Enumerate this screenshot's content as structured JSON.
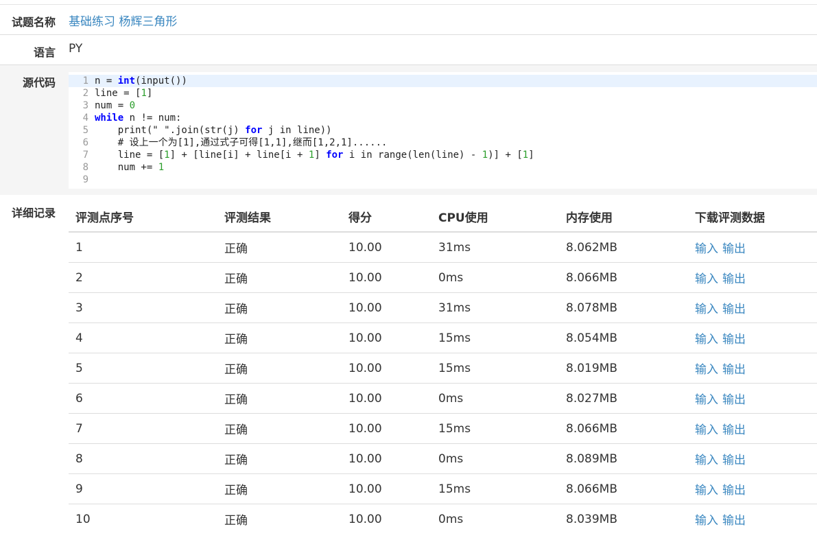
{
  "problem": {
    "label": "试题名称",
    "value": "基础练习 杨辉三角形"
  },
  "language": {
    "label": "语言",
    "value": "PY"
  },
  "source": {
    "label": "源代码",
    "lines": [
      {
        "num": "1",
        "parts": [
          [
            "t",
            "n = "
          ],
          [
            "k",
            "int"
          ],
          [
            "t",
            "(input())"
          ]
        ]
      },
      {
        "num": "2",
        "parts": [
          [
            "t",
            "line = ["
          ],
          [
            "n",
            "1"
          ],
          [
            "t",
            "]"
          ]
        ]
      },
      {
        "num": "3",
        "parts": [
          [
            "t",
            "num = "
          ],
          [
            "n",
            "0"
          ]
        ]
      },
      {
        "num": "4",
        "parts": [
          [
            "k",
            "while"
          ],
          [
            "t",
            " n != num:"
          ]
        ]
      },
      {
        "num": "5",
        "parts": [
          [
            "t",
            "    print(\" \".join(str(j) "
          ],
          [
            "k",
            "for"
          ],
          [
            "t",
            " j in line))"
          ]
        ]
      },
      {
        "num": "6",
        "parts": [
          [
            "t",
            "    # 设上一个为[1],通过式子可得[1,1],继而[1,2,1]......"
          ]
        ]
      },
      {
        "num": "7",
        "parts": [
          [
            "t",
            "    line = ["
          ],
          [
            "n",
            "1"
          ],
          [
            "t",
            "] + [line[i] + line[i + "
          ],
          [
            "n",
            "1"
          ],
          [
            "t",
            "] "
          ],
          [
            "k",
            "for"
          ],
          [
            "t",
            " i in range(len(line) - "
          ],
          [
            "n",
            "1"
          ],
          [
            "t",
            ")] + ["
          ],
          [
            "n",
            "1"
          ],
          [
            "t",
            "]"
          ]
        ]
      },
      {
        "num": "8",
        "parts": [
          [
            "t",
            "    num += "
          ],
          [
            "n",
            "1"
          ]
        ]
      },
      {
        "num": "9",
        "parts": [
          [
            "t",
            ""
          ]
        ]
      }
    ]
  },
  "detail": {
    "label": "详细记录",
    "headers": [
      "评测点序号",
      "评测结果",
      "得分",
      "CPU使用",
      "内存使用",
      "下载评测数据"
    ],
    "download": {
      "input": "输入",
      "output": "输出"
    },
    "rows": [
      {
        "id": "1",
        "result": "正确",
        "score": "10.00",
        "cpu": "31ms",
        "mem": "8.062MB"
      },
      {
        "id": "2",
        "result": "正确",
        "score": "10.00",
        "cpu": "0ms",
        "mem": "8.066MB"
      },
      {
        "id": "3",
        "result": "正确",
        "score": "10.00",
        "cpu": "31ms",
        "mem": "8.078MB"
      },
      {
        "id": "4",
        "result": "正确",
        "score": "10.00",
        "cpu": "15ms",
        "mem": "8.054MB"
      },
      {
        "id": "5",
        "result": "正确",
        "score": "10.00",
        "cpu": "15ms",
        "mem": "8.019MB"
      },
      {
        "id": "6",
        "result": "正确",
        "score": "10.00",
        "cpu": "0ms",
        "mem": "8.027MB"
      },
      {
        "id": "7",
        "result": "正确",
        "score": "10.00",
        "cpu": "15ms",
        "mem": "8.066MB"
      },
      {
        "id": "8",
        "result": "正确",
        "score": "10.00",
        "cpu": "0ms",
        "mem": "8.089MB"
      },
      {
        "id": "9",
        "result": "正确",
        "score": "10.00",
        "cpu": "15ms",
        "mem": "8.066MB"
      },
      {
        "id": "10",
        "result": "正确",
        "score": "10.00",
        "cpu": "0ms",
        "mem": "8.039MB"
      }
    ]
  },
  "colors": {
    "link": "#3a87c0",
    "keyword": "#0000ff",
    "number": "#2a9d2a",
    "active_line": "#e8f2fe"
  }
}
